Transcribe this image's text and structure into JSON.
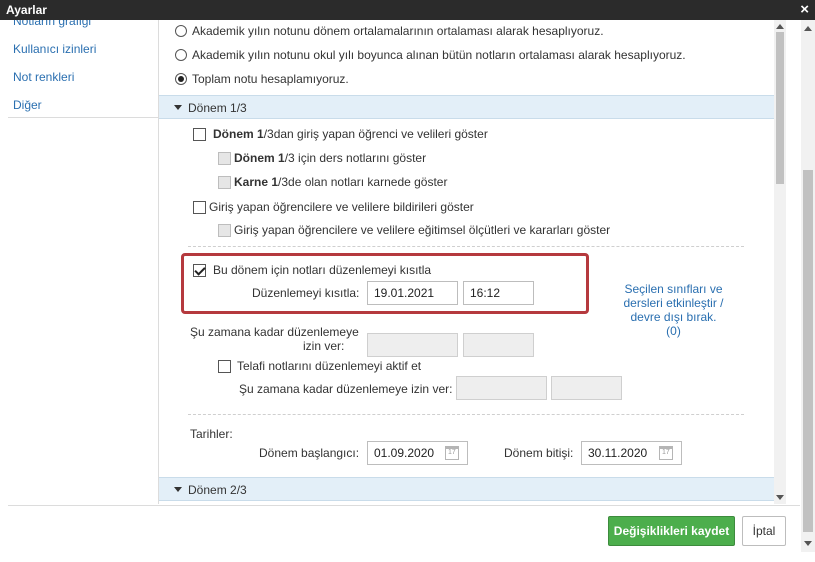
{
  "window": {
    "title": "Ayarlar",
    "close_icon": "×"
  },
  "sidebar": {
    "items": [
      {
        "label": "Notların grafiği"
      },
      {
        "label": "Kullanıcı izinleri"
      },
      {
        "label": "Not renkleri"
      },
      {
        "label": "Diğer"
      }
    ]
  },
  "averaging": {
    "options": [
      {
        "label": "Akademik yılın notunu dönem ortalamalarının ortalaması alarak hesaplıyoruz.",
        "selected": false
      },
      {
        "label": "Akademik yılın notunu okul yılı boyunca alınan bütün notların ortalaması alarak hesaplıyoruz.",
        "selected": false
      },
      {
        "label": "Toplam notu hesaplamıyoruz.",
        "selected": true
      }
    ]
  },
  "term1": {
    "header": "Dönem 1/3",
    "entry_show": {
      "bold": "Dönem 1",
      "rest": "/3dan giriş yapan öğrenci ve velileri göster",
      "checked": false
    },
    "course_grades": {
      "bold1": "Dönem 1",
      "rest": "/3 için ders notlarını göster",
      "checked": false
    },
    "report_card": {
      "bold1": "Karne 1",
      "rest": "/3de olan notları karnede göster",
      "checked": false
    },
    "notifications": {
      "label": "Giriş yapan öğrencilere ve velilere bildirileri göster",
      "checked": false
    },
    "criteria": {
      "label": "Giriş yapan öğrencilere ve velilere eğitimsel ölçütleri ve kararları göster",
      "checked": false
    },
    "restrict_edit": {
      "label": "Bu dönem için notları düzenlemeyi kısıtla",
      "checked": true
    },
    "restrict_label": "Düzenlemeyi kısıtla:",
    "restrict_date": "19.01.2021",
    "restrict_time": "16:12",
    "allow_until_label": "Şu zamana kadar düzenlemeye izin ver:",
    "allow_until_line1": "Şu zamana kadar düzenlemeye",
    "allow_until_line2": "izin ver:",
    "makeup": {
      "label": "Telafi notlarını düzenlemeyi aktif et",
      "checked": false
    },
    "makeup_until_label": "Şu zamana kadar düzenlemeye izin ver:",
    "link_line1": "Seçilen sınıfları ve",
    "link_line2": "dersleri etkinleştir /",
    "link_line3": "devre dışı bırak.",
    "link_line4": "(0)",
    "dates_label": "Tarihler:",
    "start_label": "Dönem başlangıcı:",
    "start_value": "01.09.2020",
    "end_label": "Dönem bitişi:",
    "end_value": "30.11.2020"
  },
  "term2": {
    "header": "Dönem 2/3"
  },
  "footer": {
    "save_label": "Değişiklikleri kaydet",
    "cancel_label": "İptal"
  },
  "colors": {
    "accent_save": "#4cae4c",
    "highlight_box": "#b5393e",
    "section_header": "#e3eff8",
    "link": "#2a6fb0"
  }
}
